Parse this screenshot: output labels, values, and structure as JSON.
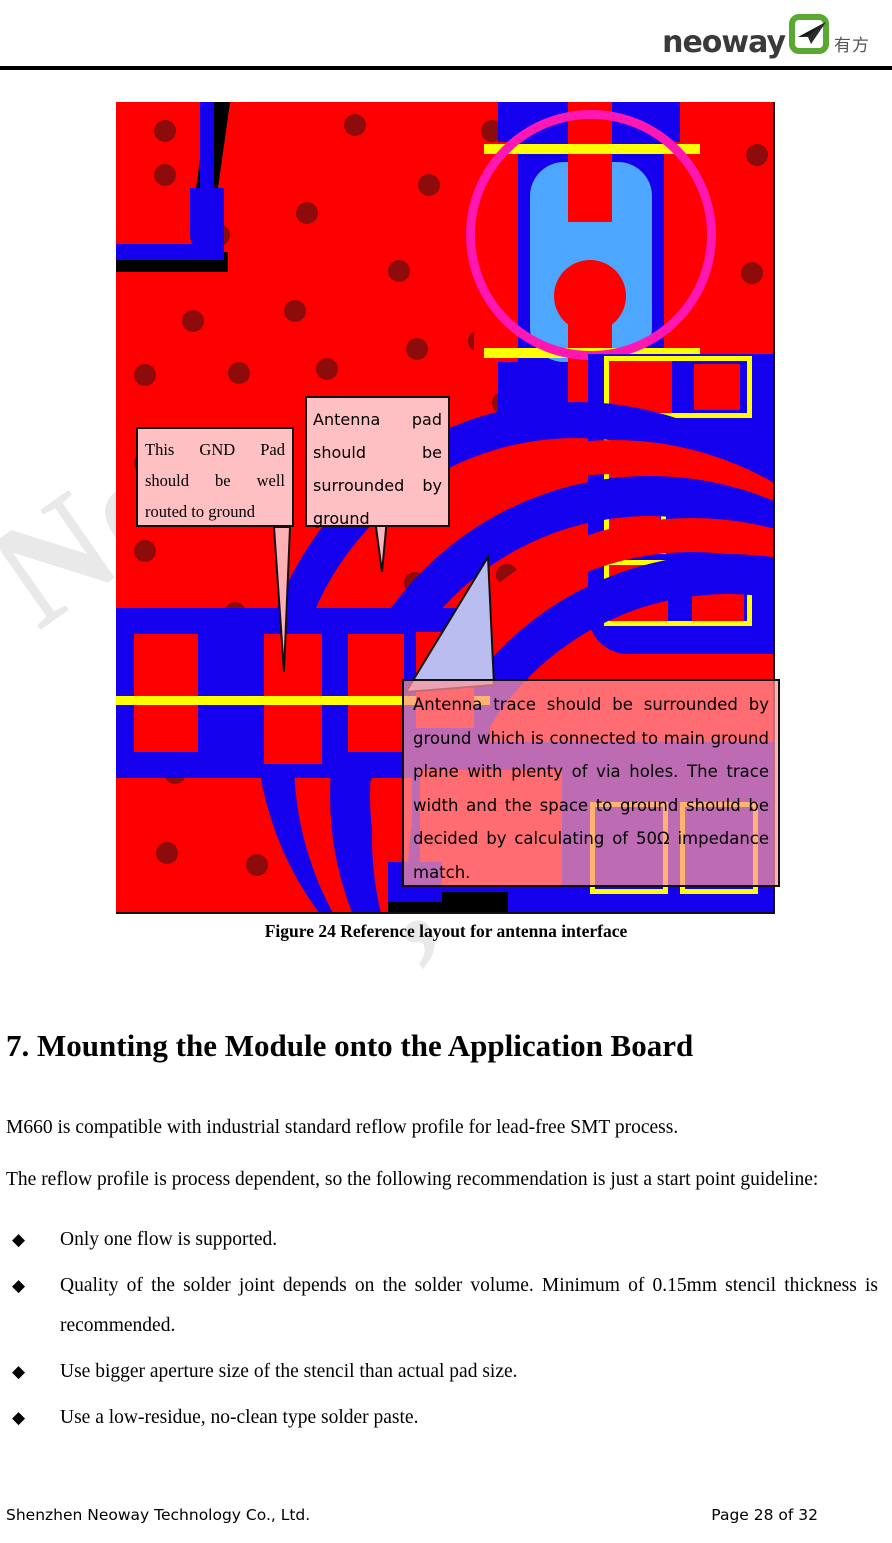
{
  "header": {
    "logo_wordmark": "neoway",
    "logo_cn": "有方",
    "logo_mark_icon": "neoway-arrow-logo-icon"
  },
  "figure": {
    "caption": "Figure 24 Reference layout for antenna interface",
    "image_alt": "pcb-antenna-reference-layout",
    "callouts": [
      {
        "id": "gnd-pad",
        "text": "This GND Pad should be well routed to ground"
      },
      {
        "id": "antenna-pad",
        "text": "Antenna pad should be surrounded by ground"
      },
      {
        "id": "antenna-trace",
        "text": "Antenna trace should be surrounded by ground which is connected to main ground plane with plenty of via holes. The trace width and the space to ground should be decided by calculating of 50Ω impedance match."
      }
    ],
    "colors": {
      "copper_red": "#fe0000",
      "copper_blue": "#1400ec",
      "via_hole": "#8e0b0b",
      "silkscreen_yellow": "#ffff00",
      "antenna_pad_blue": "#4da6ff",
      "keepout_magenta": "#ff17b4",
      "callout_fill": "#ffc0c4"
    }
  },
  "content": {
    "section_number_title": "7. Mounting the Module onto the Application Board",
    "paragraph_1": "M660 is compatible with industrial standard reflow profile for lead-free SMT process.",
    "paragraph_2": "The reflow profile is process dependent, so the following recommendation is just a start point guideline:",
    "bullet_glyph": "◆",
    "bullets": [
      "Only one flow is supported.",
      "Quality of the solder joint depends on the solder volume. Minimum of 0.15mm stencil thickness is recommended.",
      "Use bigger aperture size of the stencil than actual pad size.",
      "Use a low-residue, no-clean type solder paste."
    ]
  },
  "footer": {
    "company": "Shenzhen Neoway Technology Co., Ltd.",
    "page": "Page 28 of 32"
  },
  "watermark": {
    "line1": "Neoway",
    "line2": ", Ltd."
  }
}
